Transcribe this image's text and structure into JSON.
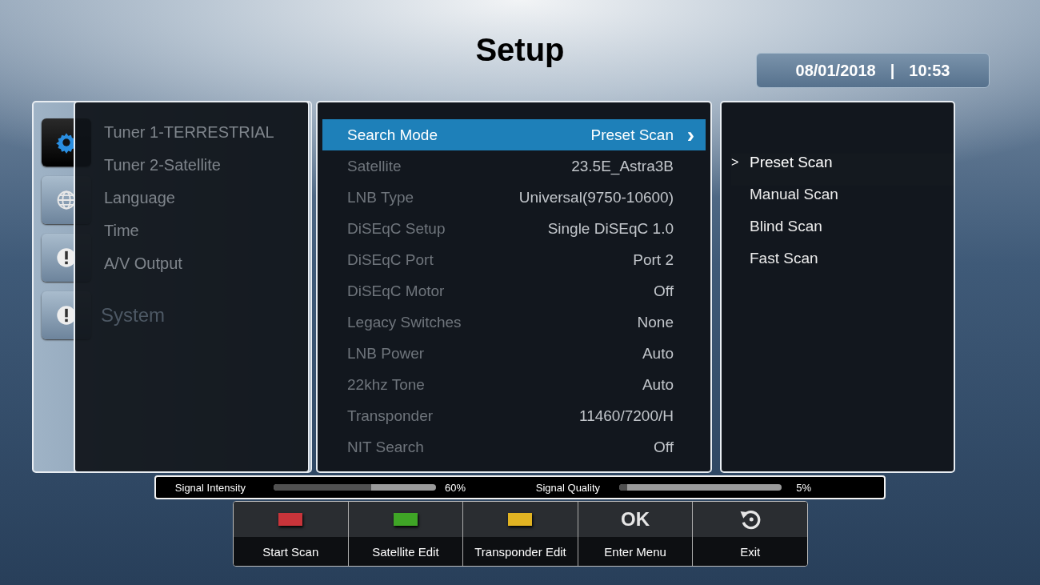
{
  "title": "Setup",
  "clock": {
    "date": "08/01/2018",
    "separator": "|",
    "time": "10:53"
  },
  "categories": [
    {
      "kind": "gear",
      "selected": true
    },
    {
      "kind": "globe",
      "selected": false
    },
    {
      "kind": "alert",
      "selected": false
    },
    {
      "kind": "alert",
      "selected": false,
      "label": "System"
    }
  ],
  "submenu": [
    {
      "label": "Tuner 1-TERRESTRIAL",
      "selected": false
    },
    {
      "label": "Tuner 2-Satellite",
      "selected": false
    },
    {
      "label": "Language",
      "selected": false
    },
    {
      "label": "Time",
      "selected": false
    },
    {
      "label": "A/V Output",
      "selected": false
    }
  ],
  "settings": [
    {
      "label": "Search Mode",
      "value": "Preset Scan",
      "selected": true,
      "disabled": false,
      "arrow": "›"
    },
    {
      "label": "Satellite",
      "value": "23.5E_Astra3B",
      "selected": false,
      "disabled": true
    },
    {
      "label": "LNB Type",
      "value": "Universal(9750-10600)",
      "selected": false,
      "disabled": true
    },
    {
      "label": "DiSEqC Setup",
      "value": "Single DiSEqC 1.0",
      "selected": false,
      "disabled": true
    },
    {
      "label": "DiSEqC Port",
      "value": "Port 2",
      "selected": false,
      "disabled": true
    },
    {
      "label": "DiSEqC Motor",
      "value": "Off",
      "selected": false,
      "disabled": true
    },
    {
      "label": "Legacy Switches",
      "value": "None",
      "selected": false,
      "disabled": true
    },
    {
      "label": "LNB Power",
      "value": "Auto",
      "selected": false,
      "disabled": true
    },
    {
      "label": "22khz Tone",
      "value": "Auto",
      "selected": false,
      "disabled": true
    },
    {
      "label": "Transponder",
      "value": "11460/7200/H",
      "selected": false,
      "disabled": true
    },
    {
      "label": "NIT Search",
      "value": "Off",
      "selected": false,
      "disabled": true
    }
  ],
  "options": [
    {
      "label": "Preset Scan",
      "selected": true
    },
    {
      "label": "Manual Scan",
      "selected": false
    },
    {
      "label": "Blind Scan",
      "selected": false
    },
    {
      "label": "Fast Scan",
      "selected": false
    }
  ],
  "option_marker": ">",
  "signal": [
    {
      "label": "Signal Intensity",
      "level": 0.6,
      "reading": "60%"
    },
    {
      "label": "Signal Quality",
      "level": 0.05,
      "reading": "5%"
    }
  ],
  "keys": [
    {
      "kind": "color",
      "color": "#c8343a",
      "label": "Start Scan"
    },
    {
      "kind": "color",
      "color": "#3fa526",
      "label": "Satellite Edit"
    },
    {
      "kind": "color",
      "color": "#e1b322",
      "label": "Transponder Edit"
    },
    {
      "kind": "text",
      "glyph": "OK",
      "label": "Enter Menu"
    },
    {
      "kind": "back",
      "label": "Exit"
    }
  ]
}
